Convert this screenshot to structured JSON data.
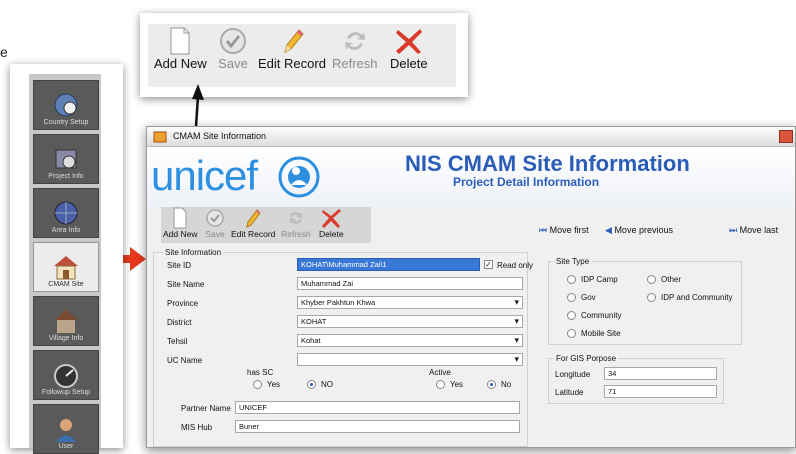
{
  "cut_text": "e",
  "top_toolbar": {
    "add_new": "Add New",
    "save": "Save",
    "edit_record": "Edit Record",
    "refresh": "Refresh",
    "delete": "Delete"
  },
  "sidebar": {
    "items": [
      {
        "label": "Country Setup",
        "icon": "globe-clock-icon"
      },
      {
        "label": "Project Info",
        "icon": "calendar-clock-icon"
      },
      {
        "label": "Area Info",
        "icon": "globe-icon"
      },
      {
        "label": "CMAM Site",
        "icon": "house-icon"
      },
      {
        "label": "Village Info",
        "icon": "village-house-icon"
      },
      {
        "label": "Followup Setup",
        "icon": "gauge-icon"
      },
      {
        "label": "User",
        "icon": "user-icon"
      }
    ],
    "selected_index": 3
  },
  "window": {
    "title": "CMAM Site Information",
    "logo_text": "unicef",
    "heading": "NIS CMAM Site Information",
    "subheading": "Project Detail Information",
    "toolbar": {
      "add_new": "Add New",
      "save": "Save",
      "edit_record": "Edit Record",
      "refresh": "Refresh",
      "delete": "Delete"
    },
    "nav": {
      "first": "Move first",
      "previous": "Move previous",
      "last": "Move last"
    },
    "site_info": {
      "group_label": "Site Information",
      "site_id_label": "Site ID",
      "site_id_value": "KOHAT\\Muhammad Zai\\1",
      "read_only_label": "Read only",
      "site_name_label": "Site Name",
      "site_name_value": "Muhammad Zai",
      "province_label": "Province",
      "province_value": "Khyber Pakhtun Khwa",
      "district_label": "District",
      "district_value": "KOHAT",
      "tehsil_label": "Tehsil",
      "tehsil_value": "Kohat",
      "uc_name_label": "UC Name",
      "uc_name_value": "",
      "has_sc_label": "has SC",
      "active_label": "Active",
      "yes": "Yes",
      "no_sc": "NO",
      "no_active": "No",
      "partner_name_label": "Partner Name",
      "partner_name_value": "UNICEF",
      "mis_hub_label": "MIS Hub",
      "mis_hub_value": "Buner"
    },
    "site_type": {
      "group_label": "Site Type",
      "options": [
        "IDP Camp",
        "Other",
        "Gov",
        "IDP and Community",
        "Community",
        "Mobile Site"
      ]
    },
    "gis": {
      "group_label": "For GIS Porpose",
      "longitude_label": "Longitude",
      "longitude_value": "34",
      "latitude_label": "Latitude",
      "latitude_value": "71"
    }
  },
  "colors": {
    "heading_blue": "#2a5db8",
    "arrow_red": "#e8391e",
    "delete_red": "#d93a2b"
  }
}
